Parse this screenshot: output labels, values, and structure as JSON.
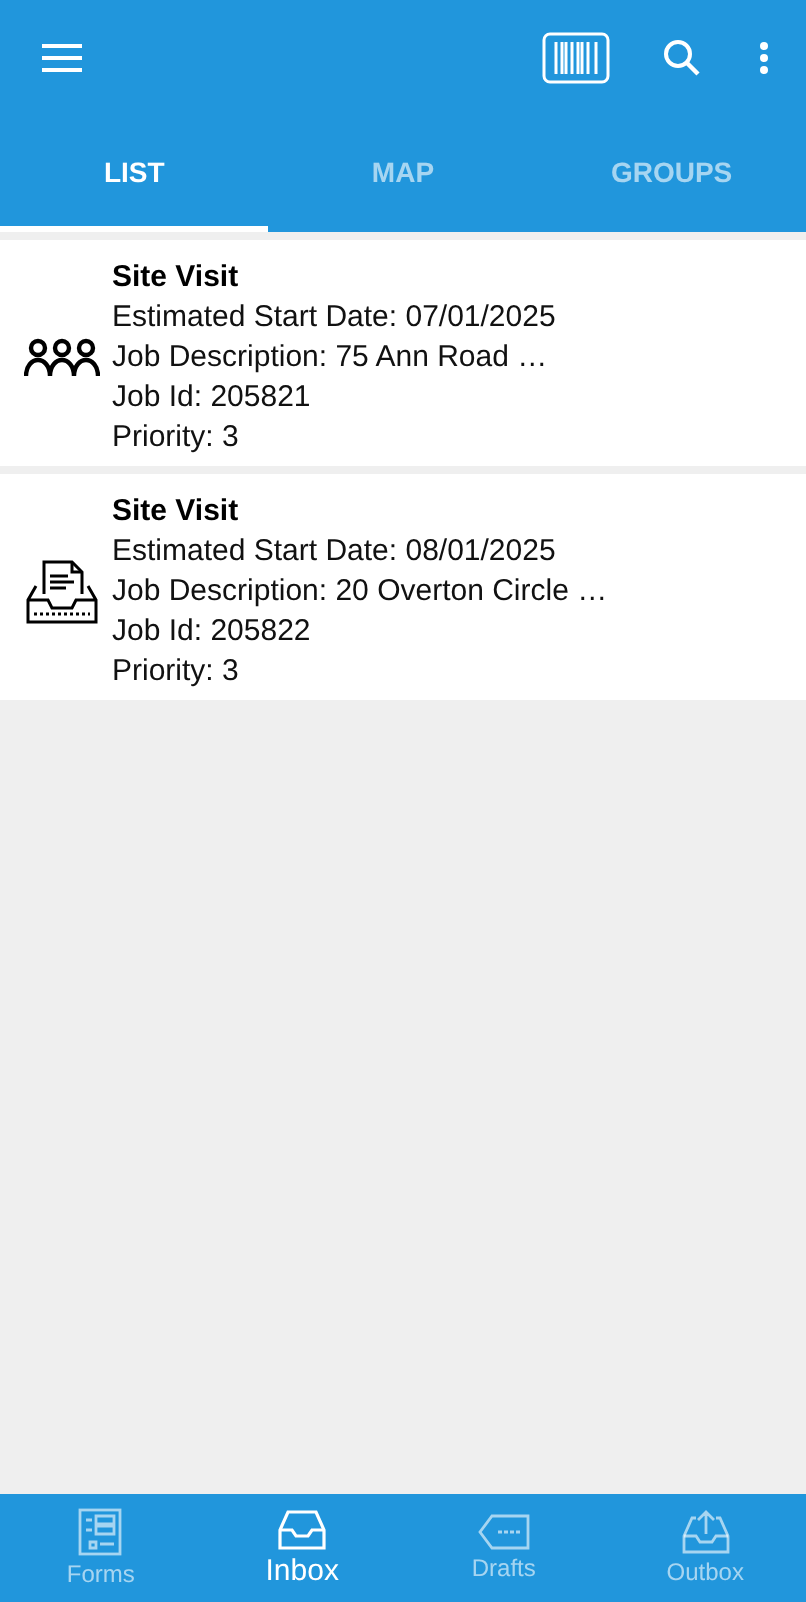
{
  "tabs": [
    {
      "label": "LIST",
      "selected": true
    },
    {
      "label": "MAP",
      "selected": false
    },
    {
      "label": "GROUPS",
      "selected": false
    }
  ],
  "jobs": [
    {
      "kind": "group",
      "title": "Site Visit",
      "lines": [
        "Estimated Start Date: 07/01/2025",
        "Job Description: 75 Ann Road …",
        "Job Id: 205821",
        "Priority: 3"
      ]
    },
    {
      "kind": "inbox",
      "title": "Site Visit",
      "lines": [
        "Estimated Start Date: 08/01/2025",
        "Job Description: 20 Overton Circle …",
        "Job Id: 205822",
        "Priority: 3"
      ]
    }
  ],
  "bottom_nav": [
    {
      "kind": "forms",
      "label": "Forms",
      "selected": false
    },
    {
      "kind": "inbox",
      "label": "Inbox",
      "selected": true
    },
    {
      "kind": "drafts",
      "label": "Drafts",
      "selected": false
    },
    {
      "kind": "outbox",
      "label": "Outbox",
      "selected": false
    }
  ]
}
